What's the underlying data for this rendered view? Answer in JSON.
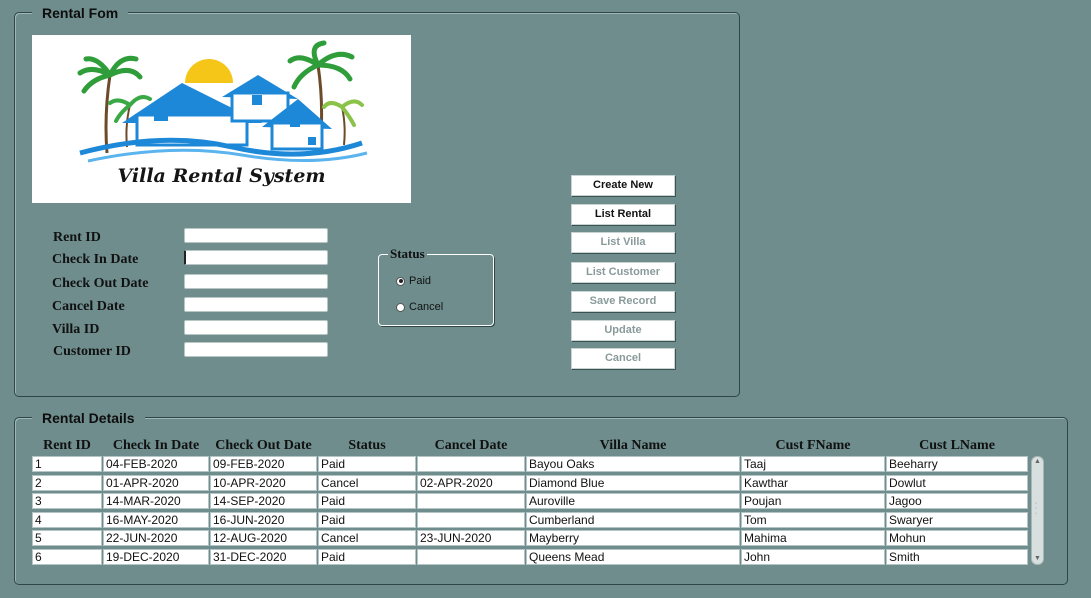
{
  "rental_form": {
    "title": "Rental Fom",
    "logo_text": "Villa Rental System",
    "labels": {
      "rent_id": "Rent ID",
      "check_in_date": "Check In Date",
      "check_out_date": "Check Out Date",
      "cancel_date": "Cancel Date",
      "villa_id": "Villa ID",
      "customer_id": "Customer ID"
    },
    "values": {
      "rent_id": "",
      "check_in_date": "",
      "check_out_date": "",
      "cancel_date": "",
      "villa_id": "",
      "customer_id": ""
    },
    "status": {
      "title": "Status",
      "options": [
        "Paid",
        "Cancel"
      ],
      "selected": "Paid"
    },
    "buttons": {
      "create_new": "Create New",
      "list_rental": "List Rental",
      "list_villa": "List Villa",
      "list_customer": "List Customer",
      "save_record": "Save Record",
      "update": "Update",
      "cancel": "Cancel"
    }
  },
  "rental_details": {
    "title": "Rental Details",
    "columns": [
      "Rent ID",
      "Check In Date",
      "Check Out Date",
      "Status",
      "Cancel Date",
      "Villa Name",
      "Cust FName",
      "Cust LName"
    ],
    "rows": [
      [
        "1",
        "04-FEB-2020",
        "09-FEB-2020",
        "Paid",
        "",
        "Bayou Oaks",
        "Taaj",
        "Beeharry"
      ],
      [
        "2",
        "01-APR-2020",
        "10-APR-2020",
        "Cancel",
        "02-APR-2020",
        "Diamond Blue",
        "Kawthar",
        "Dowlut"
      ],
      [
        "3",
        "14-MAR-2020",
        "14-SEP-2020",
        "Paid",
        "",
        "Auroville",
        "Poujan",
        "Jagoo"
      ],
      [
        "4",
        "16-MAY-2020",
        "16-JUN-2020",
        "Paid",
        "",
        "Cumberland",
        "Tom",
        "Swaryer"
      ],
      [
        "5",
        "22-JUN-2020",
        "12-AUG-2020",
        "Cancel",
        "23-JUN-2020",
        "Mayberry",
        "Mahima",
        "Mohun"
      ],
      [
        "6",
        "19-DEC-2020",
        "31-DEC-2020",
        "Paid",
        "",
        "Queens Mead",
        "John",
        "Smith"
      ]
    ]
  },
  "colors": {
    "background": "#6f8d8d",
    "logo_blue": "#1e88d8",
    "sun": "#f5c518",
    "palm": "#2e9d3a"
  }
}
